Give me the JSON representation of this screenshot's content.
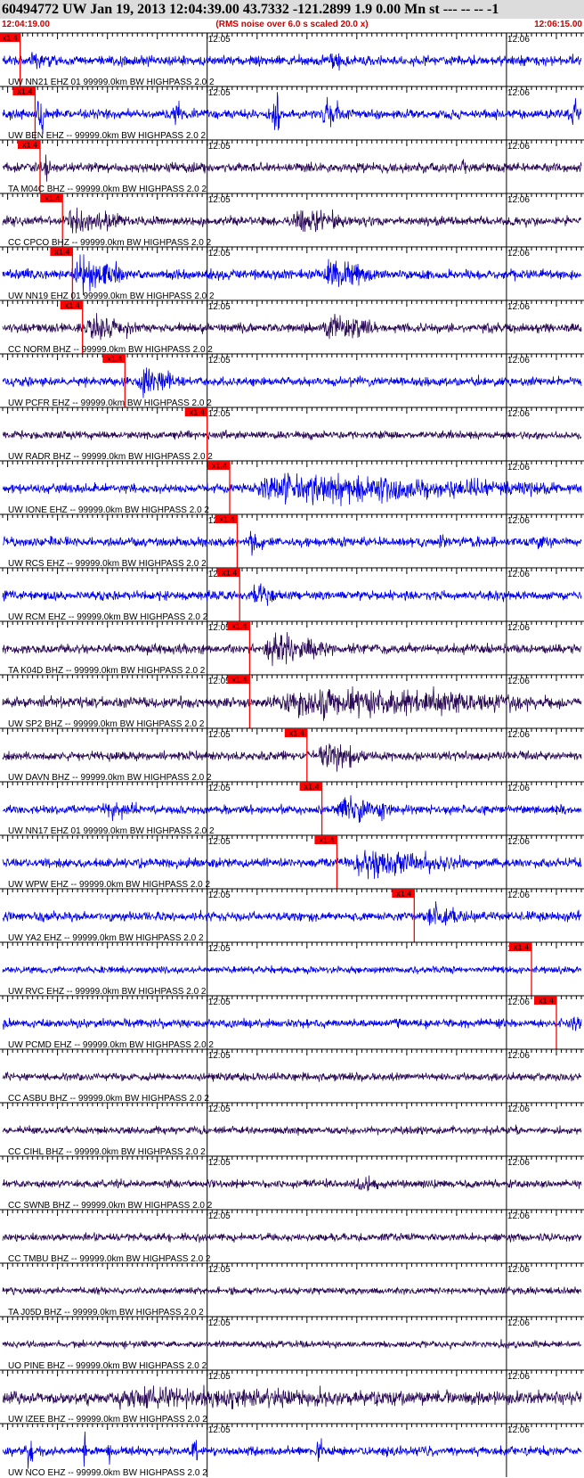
{
  "header": {
    "title": "60494772 UW Jan 19, 2013 12:04:39.00   43.7332 -121.2899  1.9 0.00 Mn st --- -- --  -1",
    "start_time": "12:04:19.00",
    "subtitle": "(RMS noise over 6.0 s scaled 20.0 x)",
    "end_time": "12:06:15.00"
  },
  "colors": {
    "blue_trace": "#0000ee",
    "dark_trace": "#2a0a55",
    "pick": "#ff0000",
    "header_bg": "#dcdcdc",
    "header_text": "#cc0000"
  },
  "chart_data": {
    "type": "line",
    "title": "60494772 UW Jan 19, 2013 12:04:39.00   43.7332 -121.2899  1.9 0.00 Mn st --- -- --  -1",
    "x_unit": "seconds after 12:04:19.00",
    "xlim": [
      0,
      116
    ],
    "minute_ticks": [
      {
        "t": 41,
        "label": "12:05"
      },
      {
        "t": 101,
        "label": "12:06"
      }
    ],
    "pick_label": "x1.4",
    "traces": [
      {
        "label": "UW NN21 EHZ 01 99999.0km BW  HIGHPASS  2.0  2",
        "color": "blue",
        "pick": 3.5,
        "amp": 0.32,
        "events": [
          {
            "t": 5,
            "dur": 6,
            "a": 0.55
          },
          {
            "t": 65,
            "dur": 5,
            "a": 0.6
          }
        ]
      },
      {
        "label": "UW BEN EHZ -- 99999.0km BW  HIGHPASS  2.0  2",
        "color": "blue",
        "pick": 6.5,
        "amp": 0.3,
        "events": [
          {
            "t": 7,
            "dur": 1.2,
            "a": 1.0
          },
          {
            "t": 34,
            "dur": 2.5,
            "a": 1.0
          },
          {
            "t": 54,
            "dur": 1.5,
            "a": 1.0
          },
          {
            "t": 64,
            "dur": 4.5,
            "a": 1.0
          },
          {
            "t": 114,
            "dur": 2,
            "a": 1.0
          }
        ]
      },
      {
        "label": "TA M04C BHZ -- 99999.0km BW  HIGHPASS  2.0  2",
        "color": "dark",
        "pick": 7.5,
        "amp": 0.3,
        "events": [
          {
            "t": 8,
            "dur": 2,
            "a": 0.8
          },
          {
            "t": 92,
            "dur": 1,
            "a": 0.6
          }
        ]
      },
      {
        "label": "CC CPCO BHZ -- 99999.0km BW  HIGHPASS  2.0  2",
        "color": "dark",
        "pick": 12,
        "amp": 0.3,
        "events": [
          {
            "t": 12,
            "dur": 14,
            "a": 0.8
          },
          {
            "t": 57,
            "dur": 14,
            "a": 0.75
          }
        ]
      },
      {
        "label": "UW NN19 EHZ 01 99999.0km BW  HIGHPASS  2.0  2",
        "color": "blue",
        "pick": 14,
        "amp": 0.32,
        "events": [
          {
            "t": 14,
            "dur": 12,
            "a": 1.0
          },
          {
            "t": 64,
            "dur": 12,
            "a": 1.0
          }
        ]
      },
      {
        "label": "CC NORM BHZ -- 99999.0km BW  HIGHPASS  2.0  2",
        "color": "dark",
        "pick": 16,
        "amp": 0.3,
        "events": [
          {
            "t": 16,
            "dur": 12,
            "a": 0.8
          },
          {
            "t": 64,
            "dur": 12,
            "a": 0.8
          }
        ]
      },
      {
        "label": "UW PCFR EHZ -- 99999.0km BW  HIGHPASS  2.0  2",
        "color": "blue",
        "pick": 24.5,
        "amp": 0.3,
        "events": [
          {
            "t": 27,
            "dur": 9,
            "a": 1.0
          }
        ]
      },
      {
        "label": "UW RADR BHZ -- 99999.0km BW  HIGHPASS  2.0  2",
        "color": "dark",
        "pick": 41,
        "amp": 0.25,
        "events": [
          {
            "t": 44,
            "dur": 1,
            "a": 0.5
          }
        ]
      },
      {
        "label": "UW IONE EHZ -- 99999.0km BW  HIGHPASS  2.0  2",
        "color": "blue",
        "pick": 45.5,
        "amp": 0.3,
        "events": [
          {
            "t": 48,
            "dur": 68,
            "a": 1.0
          }
        ]
      },
      {
        "label": "UW RCS EHZ -- 99999.0km BW  HIGHPASS  2.0  2",
        "color": "blue",
        "pick": 47,
        "amp": 0.3,
        "events": [
          {
            "t": 49,
            "dur": 4,
            "a": 0.8
          },
          {
            "t": 87,
            "dur": 3,
            "a": 0.6
          },
          {
            "t": 107,
            "dur": 3,
            "a": 0.6
          }
        ]
      },
      {
        "label": "UW RCM EHZ -- 99999.0km BW  HIGHPASS  2.0  2",
        "color": "blue",
        "pick": 47.5,
        "amp": 0.3,
        "events": [
          {
            "t": 50,
            "dur": 5,
            "a": 0.9
          }
        ]
      },
      {
        "label": "TA K04D BHZ -- 99999.0km BW  HIGHPASS  2.0  2",
        "color": "dark",
        "pick": 49.5,
        "amp": 0.3,
        "events": [
          {
            "t": 52,
            "dur": 16,
            "a": 1.0
          }
        ]
      },
      {
        "label": "UW SP2 BHZ -- 99999.0km BW  HIGHPASS  2.0  2",
        "color": "dark",
        "pick": 49.5,
        "amp": 0.35,
        "events": [
          {
            "t": 52,
            "dur": 64,
            "a": 0.95
          }
        ]
      },
      {
        "label": "UW DAVN BHZ -- 99999.0km BW  HIGHPASS  2.0  2",
        "color": "dark",
        "pick": 61,
        "amp": 0.3,
        "events": [
          {
            "t": 63,
            "dur": 10,
            "a": 1.0
          }
        ]
      },
      {
        "label": "UW NN17 EHZ 01 99999.0km BW  HIGHPASS  2.0  2",
        "color": "blue",
        "pick": 64,
        "amp": 0.3,
        "events": [
          {
            "t": 20,
            "dur": 9,
            "a": 0.6
          },
          {
            "t": 66,
            "dur": 14,
            "a": 0.9
          }
        ]
      },
      {
        "label": "UW WPW EHZ -- 99999.0km BW  HIGHPASS  2.0  2",
        "color": "blue",
        "pick": 67,
        "amp": 0.3,
        "events": [
          {
            "t": 69,
            "dur": 26,
            "a": 0.9
          }
        ]
      },
      {
        "label": "UW YA2 EHZ -- 99999.0km BW  HIGHPASS  2.0  2",
        "color": "blue",
        "pick": 82.5,
        "amp": 0.3,
        "events": [
          {
            "t": 85,
            "dur": 7,
            "a": 1.0
          }
        ]
      },
      {
        "label": "UW RVC EHZ -- 99999.0km BW  HIGHPASS  2.0  2",
        "color": "blue",
        "pick": 106,
        "amp": 0.22,
        "events": []
      },
      {
        "label": "UW PCMD EHZ -- 99999.0km BW  HIGHPASS  2.0  2",
        "color": "blue",
        "pick": 111,
        "amp": 0.28,
        "events": [
          {
            "t": 114,
            "dur": 2,
            "a": 0.7
          }
        ]
      },
      {
        "label": "CC ASBU BHZ -- 99999.0km BW  HIGHPASS  2.0  2",
        "color": "dark",
        "pick": null,
        "amp": 0.25,
        "events": []
      },
      {
        "label": "CC CIHL BHZ -- 99999.0km BW  HIGHPASS  2.0  2",
        "color": "dark",
        "pick": null,
        "amp": 0.25,
        "events": []
      },
      {
        "label": "CC SWNB BHZ -- 99999.0km BW  HIGHPASS  2.0  2",
        "color": "dark",
        "pick": null,
        "amp": 0.25,
        "events": [
          {
            "t": 70,
            "dur": 8,
            "a": 0.45
          }
        ]
      },
      {
        "label": "CC TMBU BHZ -- 99999.0km BW  HIGHPASS  2.0  2",
        "color": "dark",
        "pick": null,
        "amp": 0.25,
        "events": []
      },
      {
        "label": "TA J05D BHZ -- 99999.0km BW  HIGHPASS  2.0  2",
        "color": "dark",
        "pick": null,
        "amp": 0.22,
        "events": []
      },
      {
        "label": "UO PINE BHZ -- 99999.0km BW  HIGHPASS  2.0  2",
        "color": "dark",
        "pick": null,
        "amp": 0.22,
        "events": []
      },
      {
        "label": "UW IZEE BHZ -- 99999.0km BW  HIGHPASS  2.0  2",
        "color": "dark",
        "pick": null,
        "amp": 0.4,
        "events": [
          {
            "t": 15,
            "dur": 95,
            "a": 0.55
          }
        ]
      },
      {
        "label": "UW NCO EHZ -- 99999.0km BW  HIGHPASS  2.0  2",
        "color": "blue",
        "pick": null,
        "amp": 0.3,
        "events": [
          {
            "t": 5,
            "dur": 1,
            "a": 1.0
          },
          {
            "t": 16,
            "dur": 1,
            "a": 1.0
          },
          {
            "t": 21,
            "dur": 1,
            "a": 0.9
          },
          {
            "t": 38,
            "dur": 1,
            "a": 0.8
          },
          {
            "t": 63,
            "dur": 1,
            "a": 0.6
          }
        ]
      }
    ]
  }
}
